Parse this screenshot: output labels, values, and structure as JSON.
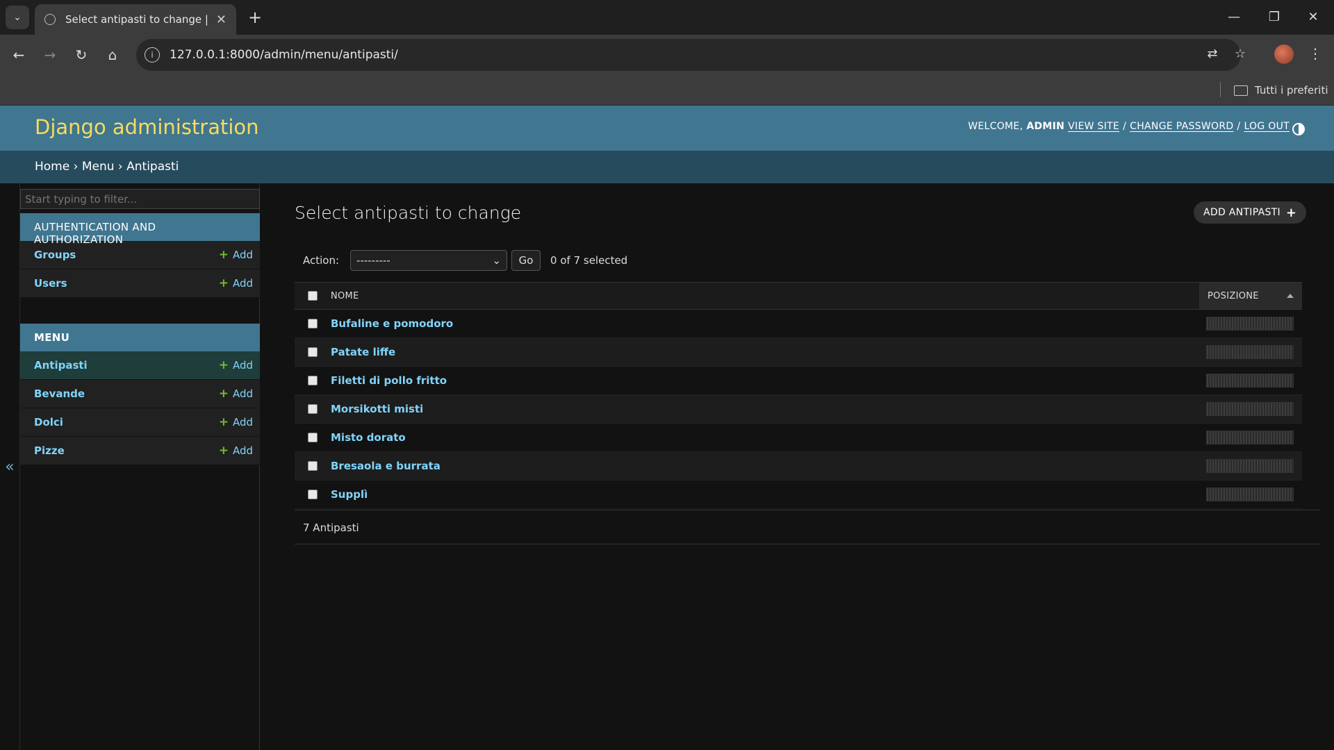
{
  "browser": {
    "tab_title": "Select antipasti to change | Django site admin",
    "url": "127.0.0.1:8000/admin/menu/antipasti/",
    "bookmarks_label": "Tutti i preferiti"
  },
  "header": {
    "site_name": "Django administration",
    "welcome": "WELCOME,",
    "username": "ADMIN",
    "view_site": "VIEW SITE",
    "change_password": "CHANGE PASSWORD",
    "log_out": "LOG OUT",
    "sep": "/"
  },
  "breadcrumbs": {
    "home": "Home",
    "menu": "Menu",
    "current": "Antipasti",
    "sep": "›"
  },
  "sidebar": {
    "filter_placeholder": "Start typing to filter...",
    "collapse_icon": "«",
    "add_label": "Add",
    "modules": [
      {
        "caption": "AUTHENTICATION AND AUTHORIZATION",
        "models": [
          "Groups",
          "Users"
        ]
      },
      {
        "caption": "MENU",
        "models": [
          "Antipasti",
          "Bevande",
          "Dolci",
          "Pizze"
        ]
      }
    ]
  },
  "content": {
    "title": "Select antipasti to change",
    "add_button": "ADD ANTIPASTI",
    "action_label": "Action:",
    "action_value": "---------",
    "go_label": "Go",
    "selected_counter": "0 of 7 selected",
    "columns": {
      "name": "NOME",
      "position": "POSIZIONE"
    },
    "rows": [
      "Bufaline e pomodoro",
      "Patate liffe",
      "Filetti di pollo fritto",
      "Morsikotti misti",
      "Misto dorato",
      "Bresaola e burrata",
      "Supplì"
    ],
    "paginator": "7 Antipasti"
  }
}
